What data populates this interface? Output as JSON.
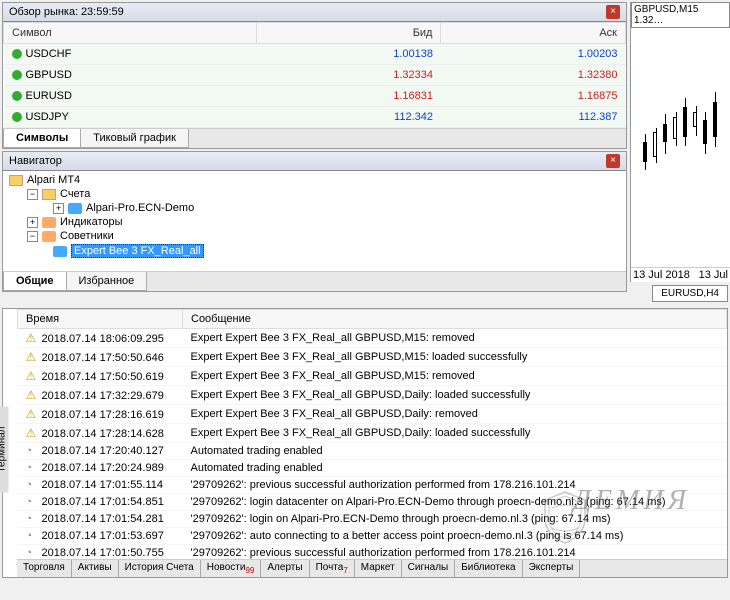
{
  "market_watch": {
    "title_prefix": "Обзор рынка:",
    "time": "23:59:59",
    "cols": {
      "symbol": "Символ",
      "bid": "Бид",
      "ask": "Аск"
    },
    "rows": [
      {
        "sym": "USDCHF",
        "bid": "1.00138",
        "ask": "1.00203",
        "color": "blue",
        "dir": "up"
      },
      {
        "sym": "GBPUSD",
        "bid": "1.32334",
        "ask": "1.32380",
        "color": "red",
        "dir": "up"
      },
      {
        "sym": "EURUSD",
        "bid": "1.16831",
        "ask": "1.16875",
        "color": "red",
        "dir": "up"
      },
      {
        "sym": "USDJPY",
        "bid": "112.342",
        "ask": "112.387",
        "color": "blue",
        "dir": "up"
      }
    ],
    "tabs": [
      "Символы",
      "Тиковый график"
    ]
  },
  "navigator": {
    "title": "Навигатор",
    "root": "Alpari MT4",
    "accounts": "Счета",
    "account1": "Alpari-Pro.ECN-Demo",
    "indicators": "Индикаторы",
    "experts": "Советники",
    "expert1": "Expert Bee 3 FX_Real_all",
    "tabs": [
      "Общие",
      "Избранное"
    ]
  },
  "chart": {
    "title": "GBPUSD,M15   1.32…",
    "date1": "13 Jul 2018",
    "date2": "13 Jul",
    "tab_active": "EURUSD,H4"
  },
  "terminal": {
    "label": "Терминал",
    "cols": {
      "time": "Время",
      "msg": "Сообщение"
    },
    "rows": [
      {
        "icon": "warn",
        "time": "2018.07.14 18:06:09.295",
        "msg": "Expert Expert Bee 3 FX_Real_all GBPUSD,M15: removed"
      },
      {
        "icon": "warn",
        "time": "2018.07.14 17:50:50.646",
        "msg": "Expert Expert Bee 3 FX_Real_all GBPUSD,M15: loaded successfully"
      },
      {
        "icon": "warn",
        "time": "2018.07.14 17:50:50.619",
        "msg": "Expert Expert Bee 3 FX_Real_all GBPUSD,M15: removed"
      },
      {
        "icon": "warn",
        "time": "2018.07.14 17:32:29.679",
        "msg": "Expert Expert Bee 3 FX_Real_all GBPUSD,Daily: loaded successfully"
      },
      {
        "icon": "warn",
        "time": "2018.07.14 17:28:16.619",
        "msg": "Expert Expert Bee 3 FX_Real_all GBPUSD,Daily: removed"
      },
      {
        "icon": "warn",
        "time": "2018.07.14 17:28:14.628",
        "msg": "Expert Expert Bee 3 FX_Real_all GBPUSD,Daily: loaded successfully"
      },
      {
        "icon": "info",
        "time": "2018.07.14 17:20:40.127",
        "msg": "Automated trading enabled"
      },
      {
        "icon": "info",
        "time": "2018.07.14 17:20:24.989",
        "msg": "Automated trading enabled"
      },
      {
        "icon": "info",
        "time": "2018.07.14 17:01:55.114",
        "msg": "'29709262': previous successful authorization performed from 178.216.101.214"
      },
      {
        "icon": "info",
        "time": "2018.07.14 17:01:54.851",
        "msg": "'29709262': login datacenter on Alpari-Pro.ECN-Demo through proecn-demo.nl.3 (ping: 67.14 ms)"
      },
      {
        "icon": "info",
        "time": "2018.07.14 17:01:54.281",
        "msg": "'29709262': login on Alpari-Pro.ECN-Demo through proecn-demo.nl.3 (ping: 67.14 ms)"
      },
      {
        "icon": "info",
        "time": "2018.07.14 17:01:53.697",
        "msg": "'29709262': auto connecting to a better access point proecn-demo.nl.3 (ping is 67.14 ms)"
      },
      {
        "icon": "info",
        "time": "2018.07.14 17:01:50.755",
        "msg": "'29709262': previous successful authorization performed from 178.216.101.214"
      }
    ],
    "tabs": [
      {
        "label": "Торговля"
      },
      {
        "label": "Активы"
      },
      {
        "label": "История Счета"
      },
      {
        "label": "Новости",
        "badge": "99"
      },
      {
        "label": "Алерты"
      },
      {
        "label": "Почта",
        "badge": "7"
      },
      {
        "label": "Маркет"
      },
      {
        "label": "Сигналы"
      },
      {
        "label": "Библиотека"
      },
      {
        "label": "Эксперты"
      }
    ]
  },
  "watermark": "ДЕМИЯ"
}
